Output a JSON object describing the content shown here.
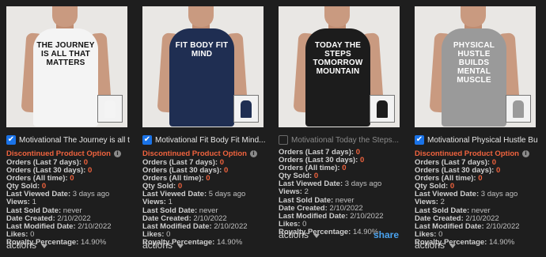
{
  "colors": {
    "background": "#1e1e1e",
    "accent": "#1a73e8",
    "warning": "#f0633e",
    "link": "#4aa3f0"
  },
  "cards": [
    {
      "title": "Motivational The Journey is all tha...",
      "checked": true,
      "shirt_color": "#f4f4f4",
      "print_color": "#111111",
      "print_text": "THE JOURNEY IS ALL THAT MATTERS",
      "discontinued": "Discontinued Product Option",
      "stats": [
        {
          "label": "Orders (Last 7 days):",
          "value": "0",
          "red": true
        },
        {
          "label": "Orders (Last 30 days):",
          "value": "0",
          "red": true
        },
        {
          "label": "Orders (All time):",
          "value": "0",
          "red": true
        },
        {
          "label": "Qty Sold:",
          "value": "0",
          "red": true
        },
        {
          "label": "Last Viewed Date:",
          "value": "3 days ago",
          "red": false
        },
        {
          "label": "Views:",
          "value": "1",
          "red": false
        },
        {
          "label": "Last Sold Date:",
          "value": "never",
          "red": false
        },
        {
          "label": "Date Created:",
          "value": "2/10/2022",
          "red": false
        },
        {
          "label": "Last Modified Date:",
          "value": "2/10/2022",
          "red": false
        },
        {
          "label": "Likes:",
          "value": "0",
          "red": false
        },
        {
          "label": "Royalty Percentage:",
          "value": "14.90%",
          "red": false
        }
      ],
      "actions": "actions",
      "share": ""
    },
    {
      "title": "Motivational Fit Body Fit Mind...",
      "checked": true,
      "shirt_color": "#1f2e52",
      "print_color": "#ffffff",
      "print_text": "FIT BODY FIT MIND",
      "discontinued": "Discontinued Product Option",
      "stats": [
        {
          "label": "Orders (Last 7 days):",
          "value": "0",
          "red": true
        },
        {
          "label": "Orders (Last 30 days):",
          "value": "0",
          "red": true
        },
        {
          "label": "Orders (All time):",
          "value": "0",
          "red": true
        },
        {
          "label": "Qty Sold:",
          "value": "0",
          "red": true
        },
        {
          "label": "Last Viewed Date:",
          "value": "5 days ago",
          "red": false
        },
        {
          "label": "Views:",
          "value": "1",
          "red": false
        },
        {
          "label": "Last Sold Date:",
          "value": "never",
          "red": false
        },
        {
          "label": "Date Created:",
          "value": "2/10/2022",
          "red": false
        },
        {
          "label": "Last Modified Date:",
          "value": "2/10/2022",
          "red": false
        },
        {
          "label": "Likes:",
          "value": "0",
          "red": false
        },
        {
          "label": "Royalty Percentage:",
          "value": "14.90%",
          "red": false
        }
      ],
      "actions": "actions",
      "share": ""
    },
    {
      "title": "Motivational Today the Steps...",
      "checked": false,
      "shirt_color": "#1c1c1c",
      "print_color": "#ffffff",
      "print_text": "TODAY THE STEPS TOMORROW MOUNTAIN",
      "discontinued": "",
      "stats": [
        {
          "label": "Orders (Last 7 days):",
          "value": "0",
          "red": true
        },
        {
          "label": "Orders (Last 30 days):",
          "value": "0",
          "red": true
        },
        {
          "label": "Orders (All time):",
          "value": "0",
          "red": true
        },
        {
          "label": "Qty Sold:",
          "value": "0",
          "red": true
        },
        {
          "label": "Last Viewed Date:",
          "value": "3 days ago",
          "red": false
        },
        {
          "label": "Views:",
          "value": "2",
          "red": false
        },
        {
          "label": "Last Sold Date:",
          "value": "never",
          "red": false
        },
        {
          "label": "Date Created:",
          "value": "2/10/2022",
          "red": false
        },
        {
          "label": "Last Modified Date:",
          "value": "2/10/2022",
          "red": false
        },
        {
          "label": "Likes:",
          "value": "0",
          "red": false
        },
        {
          "label": "Royalty Percentage:",
          "value": "14.90%",
          "red": false
        }
      ],
      "actions": "actions",
      "share": "share"
    },
    {
      "title": "Motivational Physical Hustle Build...",
      "checked": true,
      "shirt_color": "#9a9a9a",
      "print_color": "#ffffff",
      "print_text": "PHYSICAL HUSTLE BUILDS MENTAL MUSCLE",
      "discontinued": "Discontinued Product Option",
      "stats": [
        {
          "label": "Orders (Last 7 days):",
          "value": "0",
          "red": true
        },
        {
          "label": "Orders (Last 30 days):",
          "value": "0",
          "red": true
        },
        {
          "label": "Orders (All time):",
          "value": "0",
          "red": true
        },
        {
          "label": "Qty Sold:",
          "value": "0",
          "red": true
        },
        {
          "label": "Last Viewed Date:",
          "value": "3 days ago",
          "red": false
        },
        {
          "label": "Views:",
          "value": "2",
          "red": false
        },
        {
          "label": "Last Sold Date:",
          "value": "never",
          "red": false
        },
        {
          "label": "Date Created:",
          "value": "2/10/2022",
          "red": false
        },
        {
          "label": "Last Modified Date:",
          "value": "2/10/2022",
          "red": false
        },
        {
          "label": "Likes:",
          "value": "0",
          "red": false
        },
        {
          "label": "Royalty Percentage:",
          "value": "14.90%",
          "red": false
        }
      ],
      "actions": "actions",
      "share": ""
    }
  ]
}
